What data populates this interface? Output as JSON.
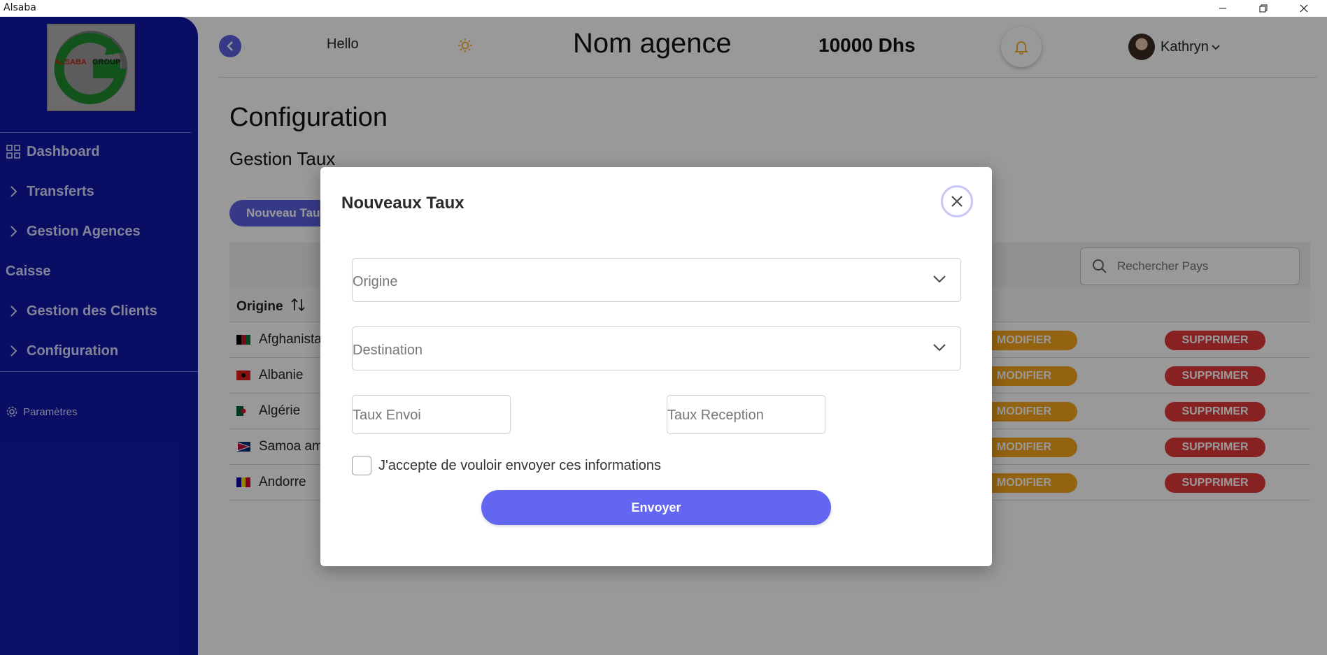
{
  "window": {
    "title": "Alsaba"
  },
  "sidebar": {
    "logo_text": "ALSABA GROUP",
    "items": [
      {
        "label": "Dashboard",
        "icon": "grid-icon"
      },
      {
        "label": "Transferts",
        "icon": "chevron-right-icon"
      },
      {
        "label": "Gestion Agences",
        "icon": "chevron-right-icon"
      },
      {
        "label": "Caisse",
        "icon": ""
      },
      {
        "label": "Gestion des Clients",
        "icon": "chevron-right-icon"
      },
      {
        "label": "Configuration",
        "icon": "chevron-right-icon"
      }
    ],
    "settings_label": "Paramètres"
  },
  "header": {
    "greeting": "Hello",
    "agency_name": "Nom agence",
    "balance": "10000 Dhs",
    "user_name": "Kathryn"
  },
  "page": {
    "title": "Configuration",
    "section": "Gestion Taux",
    "new_button": "Nouveau Taux",
    "search_placeholder": "Rechercher Pays",
    "column_origin": "Origine",
    "rows": [
      {
        "country": "Afghanistan",
        "flag": "af"
      },
      {
        "country": "Albanie",
        "flag": "al"
      },
      {
        "country": "Algérie",
        "flag": "dz"
      },
      {
        "country": "Samoa américaines",
        "flag": "as"
      },
      {
        "country": "Andorre",
        "flag": "ad"
      }
    ],
    "modify_label": "MODIFIER",
    "delete_label": "SUPPRIMER"
  },
  "modal": {
    "title": "Nouveaux Taux",
    "origin_placeholder": "Origine",
    "destination_placeholder": "Destination",
    "send_rate_placeholder": "Taux Envoi",
    "receive_rate_placeholder": "Taux Reception",
    "checkbox_label": "J'accepte de vouloir envoyer ces informations",
    "submit_label": "Envoyer"
  },
  "colors": {
    "sidebar": "#1017a7",
    "accent": "#6366f1",
    "modify": "#f5a51e",
    "delete": "#e33a3a"
  }
}
